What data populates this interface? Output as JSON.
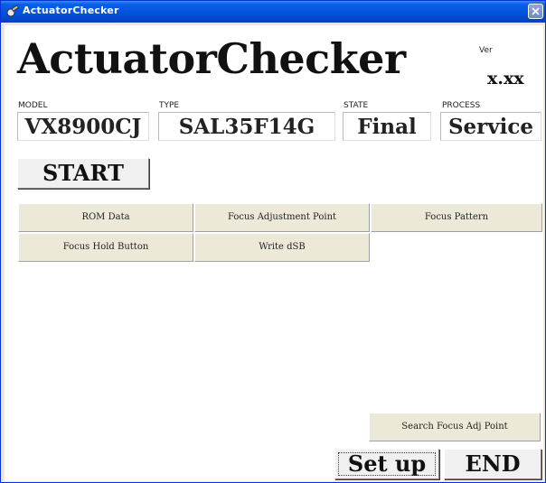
{
  "window": {
    "title": "ActuatorChecker",
    "icon": "app-icon",
    "close_icon": "close-icon"
  },
  "header": {
    "app_title": "ActuatorChecker",
    "ver_label": "Ver",
    "ver_value": "x.xx"
  },
  "fields": {
    "model": {
      "label": "MODEL",
      "value": "VX8900CJ"
    },
    "type": {
      "label": "TYPE",
      "value": "SAL35F14G"
    },
    "state": {
      "label": "STATE",
      "value": "Final"
    },
    "process": {
      "label": "PROCESS",
      "value": "Service"
    }
  },
  "start_label": "START",
  "function_buttons": {
    "rom_data": "ROM Data",
    "focus_adjustment_point": "Focus Adjustment Point",
    "focus_pattern": "Focus Pattern",
    "focus_hold_button": "Focus Hold Button",
    "write_dsb": "Write dSB",
    "search_focus_adj_point": "Search Focus Adj Point"
  },
  "footer": {
    "setup_label": "Set up",
    "end_label": "END"
  },
  "colors": {
    "titlebar": "#0050dc",
    "window_bg": "#ece9d8",
    "client_bg": "#ffffff"
  }
}
